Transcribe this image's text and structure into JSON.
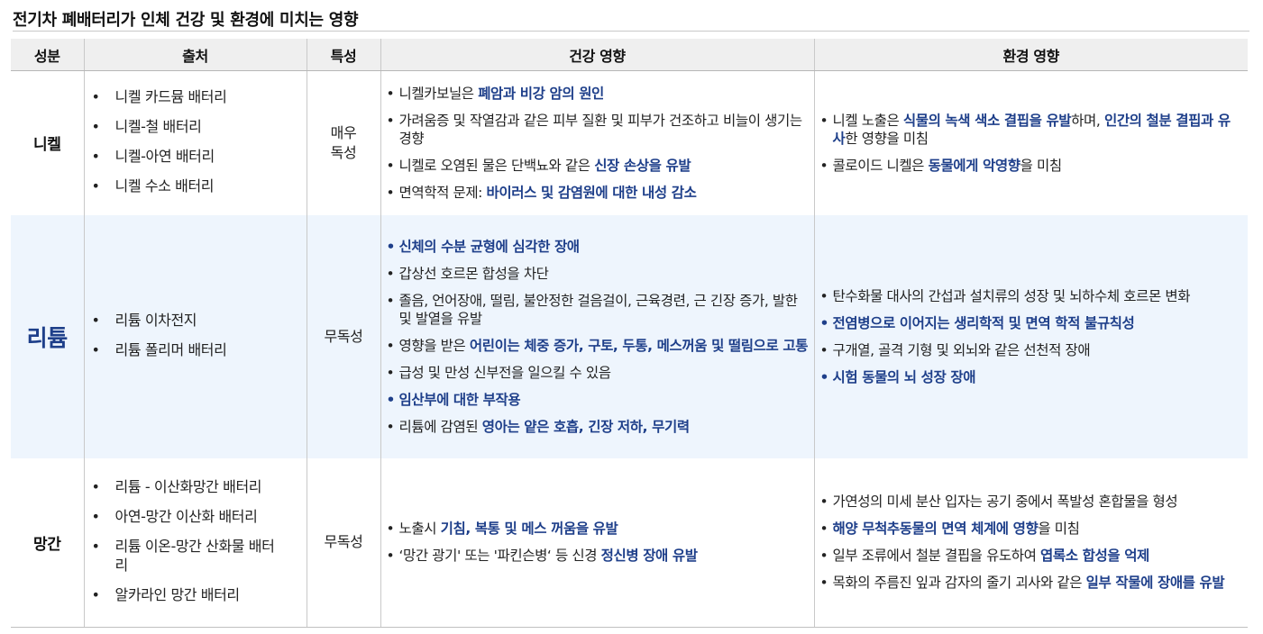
{
  "title": "전기차 폐배터리가 인체 건강 및 환경에 미치는 영향",
  "headers": [
    "성분",
    "출처",
    "특성",
    "건강 영향",
    "환경 영향"
  ],
  "rows": [
    {
      "component": "니켈",
      "sources": [
        "니켈 카드뮴 배터리",
        "니켈-철 배터리",
        "니켈-아연 배터리",
        "니켈 수소 배터리"
      ],
      "property": "매우 독성",
      "health": [
        {
          "pre": "니켈카보닐은 ",
          "em": "폐암과 비강 암의 원인",
          "post": ""
        },
        {
          "pre": "가려움증 및 작열감과 같은 피부 질환 및 피부가 건조하고 비늘이 생기는 경향",
          "em": "",
          "post": ""
        },
        {
          "pre": "니켈로 오염된 물은 단백뇨와 같은 ",
          "em": "신장 손상을 유발",
          "post": ""
        },
        {
          "pre": "면역학적 문제: ",
          "em": "바이러스 및 감염원에 대한 내성 감소",
          "post": ""
        }
      ],
      "environment": [
        {
          "pre": "니켈 노출은 ",
          "em": "식물의 녹색 색소 결핍을 유발",
          "post": "하며, ",
          "em2": "인간의 철분 결핍과 유사",
          "post2": "한 영향을 미침"
        },
        {
          "pre": "콜로이드 니켈은 ",
          "em": "동물에게 악영향",
          "post": "을 미침"
        }
      ]
    },
    {
      "component": "리튬",
      "sources": [
        "리튬 이차전지",
        "리튬 폴리머 배터리"
      ],
      "property": "무독성",
      "health": [
        {
          "pre": "",
          "em": "신체의 수분 균형에 심각한 장애",
          "post": ""
        },
        {
          "pre": "갑상선 호르몬 합성을 차단",
          "em": "",
          "post": ""
        },
        {
          "pre": "졸음, 언어장애, 떨림, 불안정한 걸음걸이, 근육경련, 근 긴장 증가, 발한 및 발열을 유발",
          "em": "",
          "post": ""
        },
        {
          "pre": "영향을 받은 ",
          "em": "어린이는 체중 증가, 구토, 두통, 메스꺼움 및 떨림으로 고통",
          "post": ""
        },
        {
          "pre": "급성 및 만성 신부전을 일으킬 수 있음",
          "em": "",
          "post": ""
        },
        {
          "pre": "",
          "em": "임산부에 대한 부작용",
          "post": ""
        },
        {
          "pre": "리튬에 감염된 ",
          "em": "영아는 얕은 호흡, 긴장 저하, 무기력",
          "post": ""
        }
      ],
      "environment": [
        {
          "pre": "탄수화물 대사의 간섭과 설치류의 성장 및 뇌하수체 호르몬 변화",
          "em": "",
          "post": ""
        },
        {
          "pre": "",
          "em": "전염병으로 이어지는 생리학적 및 면역 학적 불규칙성",
          "post": ""
        },
        {
          "pre": "구개열, 골격 기형 및 외뇌와 같은 선천적 장애",
          "em": "",
          "post": ""
        },
        {
          "pre": "",
          "em": "시험 동물의 뇌 성장 장애",
          "post": ""
        }
      ]
    },
    {
      "component": "망간",
      "sources": [
        "리튬 - 이산화망간 배터리",
        "아연-망간 이산화 배터리",
        "리튬 이온-망간 산화물 배터리",
        "알카라인 망간 배터리"
      ],
      "property": "무독성",
      "health": [
        {
          "pre": "노출시 ",
          "em": "기침, 복통 및 메스 꺼움을 유발",
          "post": ""
        },
        {
          "pre": "‘망간 광기' 또는 '파킨슨병‘ 등 신경 ",
          "em": "정신병 장애 유발",
          "post": ""
        }
      ],
      "environment": [
        {
          "pre": "가연성의 미세 분산 입자는 공기 중에서 폭발성 혼합물을 형성",
          "em": "",
          "post": ""
        },
        {
          "pre": "",
          "em": "해양 무척추동물의 면역 체계에 영향",
          "post": "을 미침"
        },
        {
          "pre": "일부 조류에서 철분 결핍을 유도하여 ",
          "em": "엽록소 합성을 억제",
          "post": ""
        },
        {
          "pre": "목화의 주름진 잎과 감자의 줄기 괴사와 같은 ",
          "em": "일부 작물에 장애를 유발",
          "post": ""
        }
      ]
    }
  ]
}
